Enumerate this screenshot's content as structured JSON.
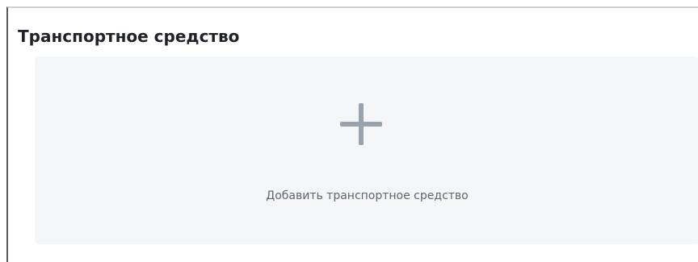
{
  "section": {
    "title": "Транспортное средство"
  },
  "add_vehicle": {
    "icon": "plus-icon",
    "label": "Добавить транспортное средство"
  }
}
